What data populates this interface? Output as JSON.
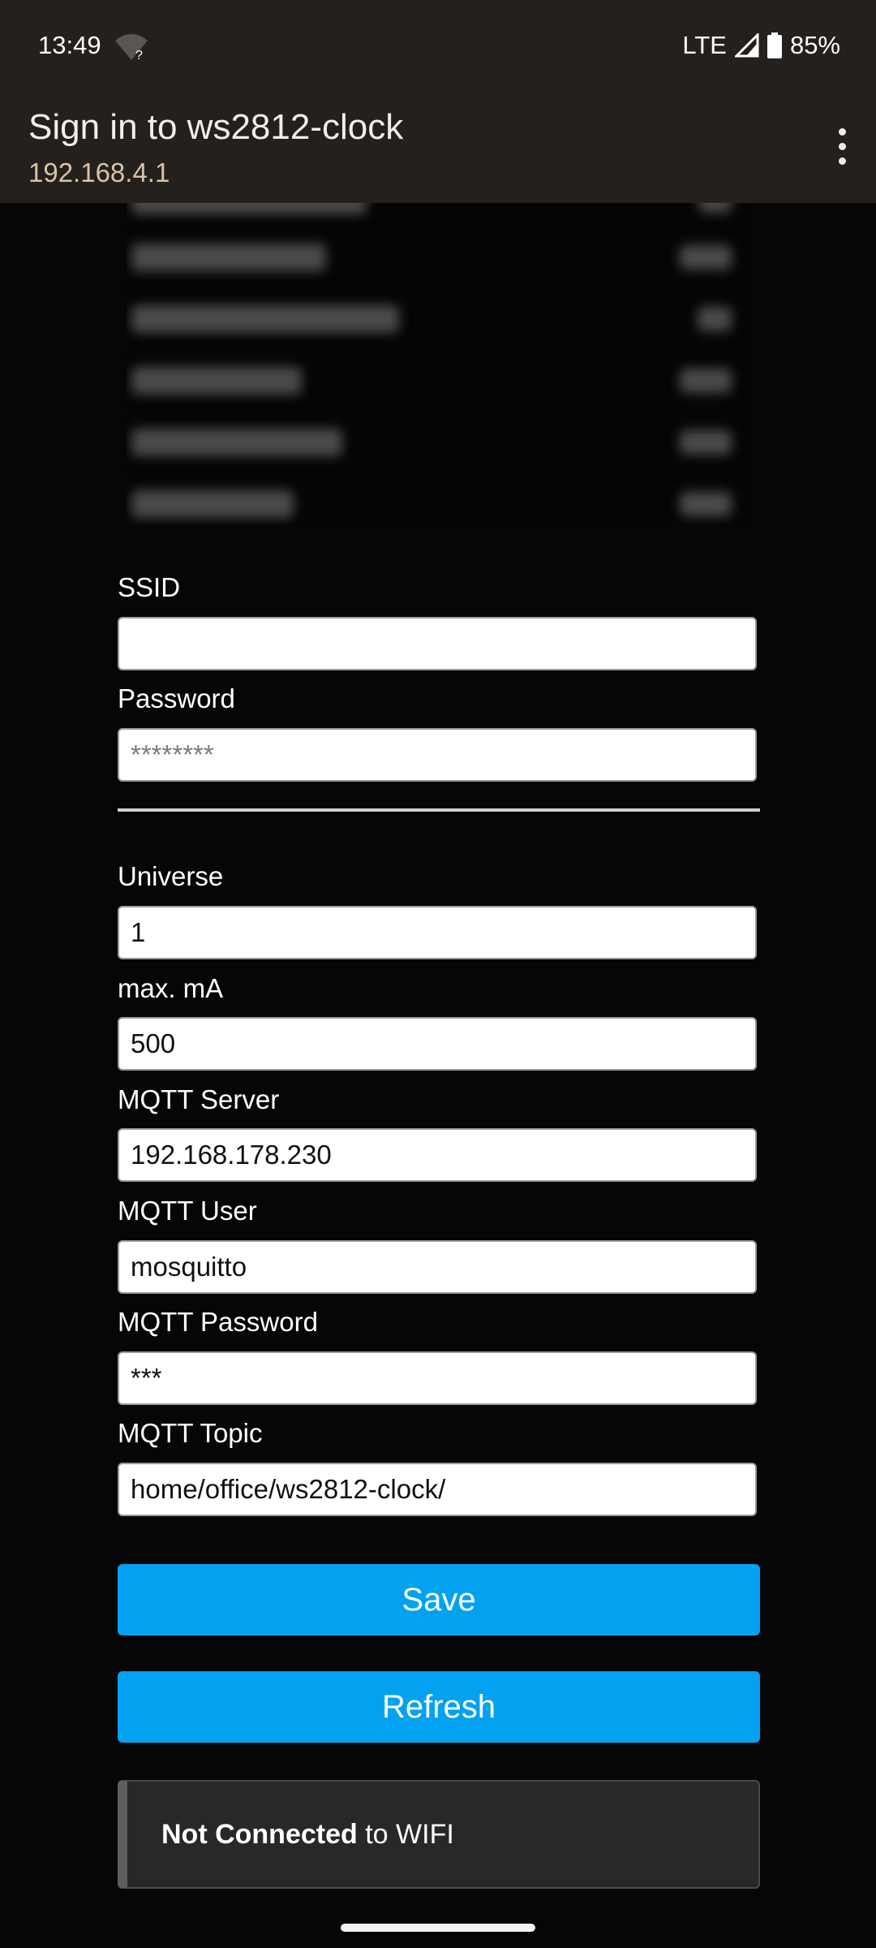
{
  "status_bar": {
    "time": "13:49",
    "network": "LTE",
    "battery": "85%"
  },
  "app_bar": {
    "title": "Sign in to ws2812-clock",
    "url": "192.168.4.1"
  },
  "networks": [
    {
      "name": "",
      "quality": ""
    },
    {
      "name": "",
      "quality": ""
    },
    {
      "name": "",
      "quality": ""
    },
    {
      "name": "",
      "quality": ""
    },
    {
      "name": "",
      "quality": ""
    },
    {
      "name": "",
      "quality": ""
    }
  ],
  "wifi": {
    "ssid_label": "SSID",
    "ssid_value": "",
    "password_label": "Password",
    "password_placeholder": "********"
  },
  "settings": {
    "universe_label": "Universe",
    "universe_value": "1",
    "max_ma_label": "max. mA",
    "max_ma_value": "500",
    "mqtt_server_label": "MQTT Server",
    "mqtt_server_value": "192.168.178.230",
    "mqtt_user_label": "MQTT User",
    "mqtt_user_value": "mosquitto",
    "mqtt_password_label": "MQTT Password",
    "mqtt_password_value": "***",
    "mqtt_topic_label": "MQTT Topic",
    "mqtt_topic_value": "home/office/ws2812-clock/"
  },
  "buttons": {
    "save": "Save",
    "refresh": "Refresh"
  },
  "status_notice": {
    "bold": "Not Connected",
    "rest": " to WIFI"
  },
  "colors": {
    "button_blue": "#02a2f1",
    "app_bar": "#24201d",
    "url_text": "#d9c2a8"
  },
  "icons": [
    "wifi-unknown-icon",
    "cell-signal-icon",
    "battery-icon",
    "more-vert-icon"
  ]
}
